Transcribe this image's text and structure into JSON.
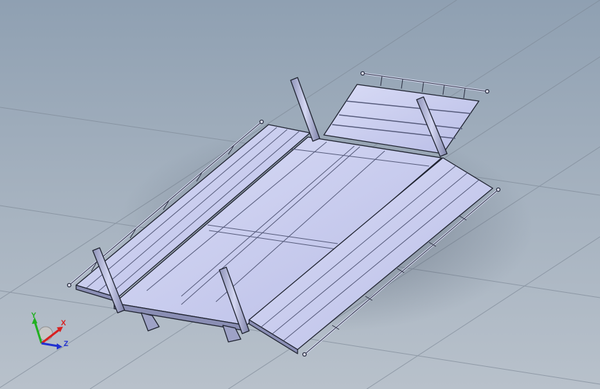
{
  "view": {
    "background_top": "#8fa0b2",
    "background_bottom": "#b8c1cb",
    "model_face_color": "#c9cdf0",
    "model_edge_color": "#1f2330"
  },
  "triad": {
    "x_label": "X",
    "y_label": "Y",
    "z_label": "Z",
    "x_color": "#d82020",
    "y_color": "#20b020",
    "z_color": "#2030d0"
  }
}
